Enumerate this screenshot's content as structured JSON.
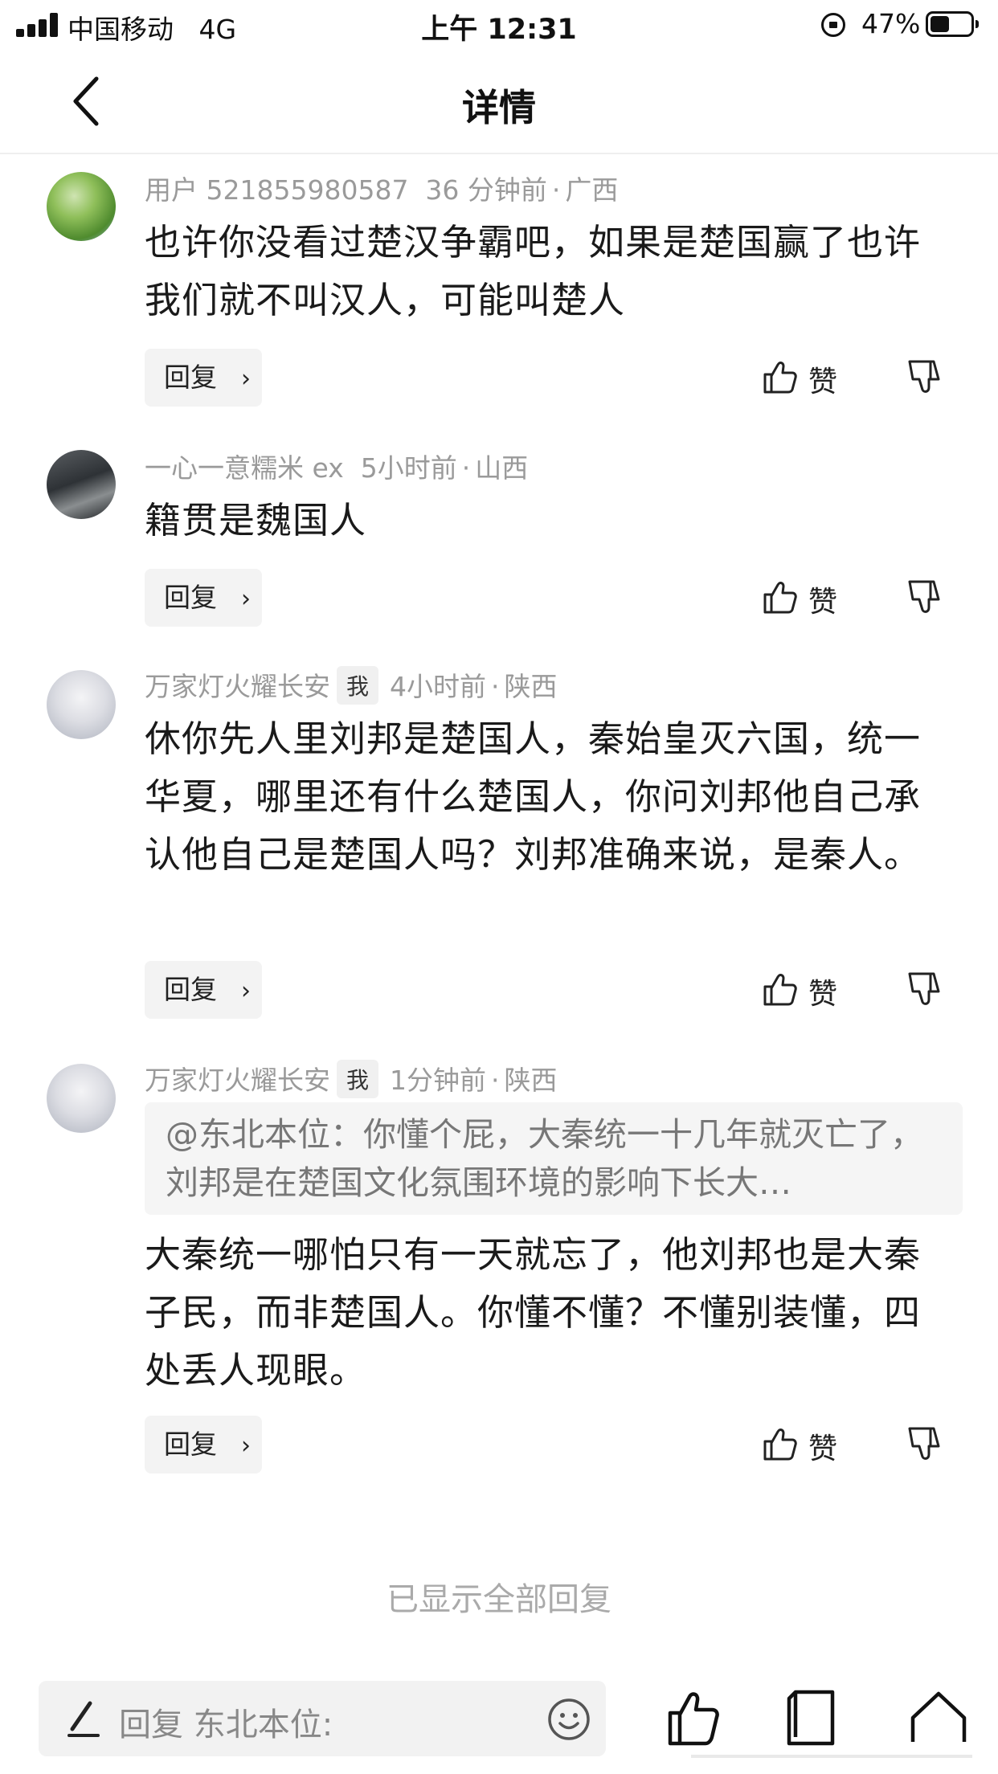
{
  "status_bar": {
    "carrier": "中国移动",
    "network": "4G",
    "time": "上午 12:31",
    "battery_percent": "47%",
    "battery_level": 0.47
  },
  "nav": {
    "title": "详情",
    "back_icon": "chevron-left-icon"
  },
  "comments": [
    {
      "user": "用户 521855980587",
      "is_me": false,
      "time": "36 分钟前",
      "location": "广西",
      "quote": "",
      "text": "也许你没看过楚汉争霸吧，如果是楚国赢了也许我们就不叫汉人，可能叫楚人",
      "reply_label": "回复",
      "like_label": "赞"
    },
    {
      "user": "一心一意糯米 ex",
      "is_me": false,
      "time": "5小时前",
      "location": "山西",
      "quote": "",
      "text": "籍贯是魏国人",
      "reply_label": "回复",
      "like_label": "赞"
    },
    {
      "user": "万家灯火耀长安",
      "is_me": true,
      "me_badge": "我",
      "time": "4小时前",
      "location": "陕西",
      "quote": "",
      "text": "休你先人里刘邦是楚国人，秦始皇灭六国，统一华夏，哪里还有什么楚国人，你问刘邦他自己承认他自己是楚国人吗？刘邦准确来说，是秦人。",
      "reply_label": "回复",
      "like_label": "赞"
    },
    {
      "user": "万家灯火耀长安",
      "is_me": true,
      "me_badge": "我",
      "time": "1分钟前",
      "location": "陕西",
      "quote": "@东北本位：你懂个屁，大秦统一十几年就灭亡了，刘邦是在楚国文化氛围环境的影响下长大…",
      "text": "大秦统一哪怕只有一天就忘了，他刘邦也是大秦子民，而非楚国人。你懂不懂？不懂别装懂，四处丢人现眼。",
      "reply_label": "回复",
      "like_label": "赞"
    }
  ],
  "footer_note": "已显示全部回复",
  "bottom_bar": {
    "input_placeholder": "回复 东北本位:",
    "icons": [
      "pen-icon",
      "emoji-icon",
      "thumbs-up-icon",
      "comment-icon",
      "share-icon"
    ]
  },
  "colors": {
    "meta_gray": "#9a9a9a",
    "text_dark": "#1a1a1a",
    "button_bg": "#f3f3f3"
  }
}
